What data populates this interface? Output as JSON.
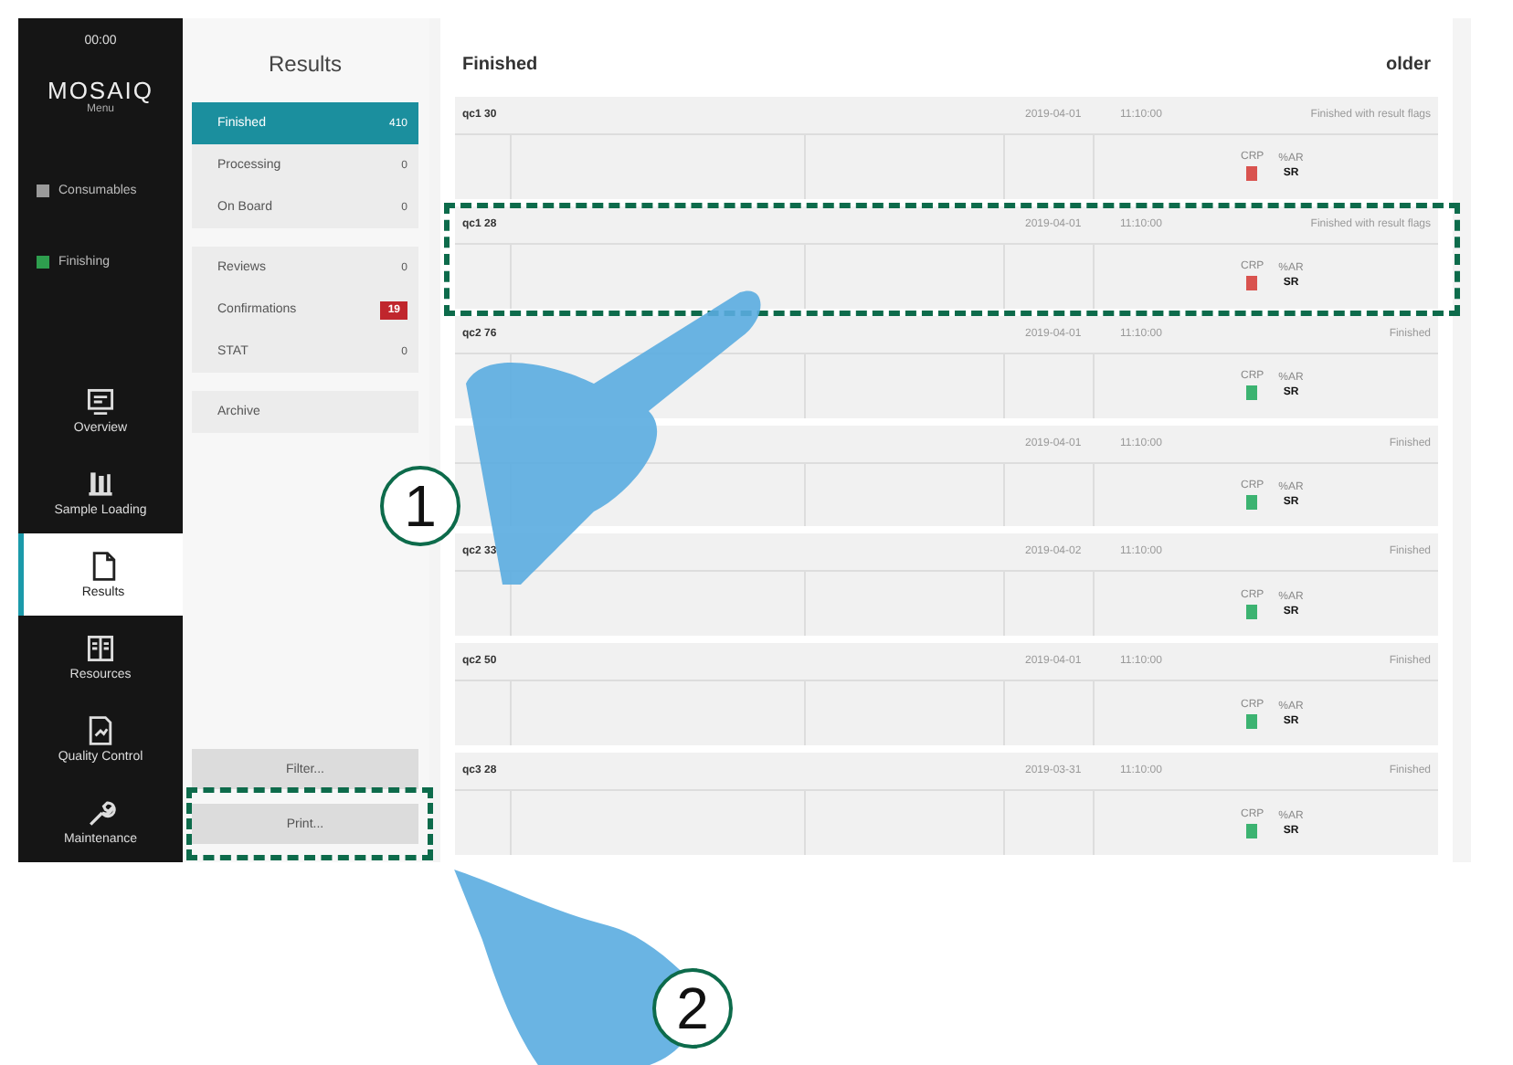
{
  "nav": {
    "time": "00:00",
    "logo": "MOSAIQ",
    "logo_sub": "Menu",
    "status_items": [
      {
        "label": "Consumables",
        "color": "#9a9a9a"
      },
      {
        "label": "Finishing",
        "color": "#2e9e4e"
      }
    ],
    "items": [
      {
        "label": "Overview",
        "selected": false
      },
      {
        "label": "Sample Loading",
        "selected": false
      },
      {
        "label": "Results",
        "selected": true
      },
      {
        "label": "Resources",
        "selected": false
      },
      {
        "label": "Quality Control",
        "selected": false
      },
      {
        "label": "Maintenance",
        "selected": false
      }
    ]
  },
  "panel": {
    "title": "Results",
    "groups": [
      [
        {
          "label": "Finished",
          "count": "410",
          "selected": true,
          "alert": false
        },
        {
          "label": "Processing",
          "count": "0",
          "selected": false,
          "alert": false
        },
        {
          "label": "On Board",
          "count": "0",
          "selected": false,
          "alert": false
        }
      ],
      [
        {
          "label": "Reviews",
          "count": "0",
          "selected": false,
          "alert": false
        },
        {
          "label": "Confirmations",
          "count": "19",
          "selected": false,
          "alert": true
        },
        {
          "label": "STAT",
          "count": "0",
          "selected": false,
          "alert": false
        }
      ],
      [
        {
          "label": "Archive",
          "selected": false
        }
      ]
    ],
    "buttons": [
      "Filter...",
      "Print..."
    ]
  },
  "main": {
    "title": "Finished",
    "sort": "older",
    "rows": [
      {
        "id": "qc1 30",
        "date": "2019-04-01",
        "time": "11:10:00",
        "status": "Finished with result flags",
        "code": "CRP",
        "unit": "%AR",
        "color": "#d9534f",
        "value": "SR",
        "highlighted": false
      },
      {
        "id": "qc1 28",
        "date": "2019-04-01",
        "time": "11:10:00",
        "status": "Finished with result flags",
        "code": "CRP",
        "unit": "%AR",
        "color": "#d9534f",
        "value": "SR",
        "highlighted": true
      },
      {
        "id": "qc2 76",
        "date": "2019-04-01",
        "time": "11:10:00",
        "status": "Finished",
        "code": "CRP",
        "unit": "%AR",
        "color": "#3cb371",
        "value": "SR",
        "highlighted": false
      },
      {
        "date": "2019-04-01",
        "time": "11:10:00",
        "status": "Finished",
        "code": "CRP",
        "unit": "%AR",
        "color": "#3cb371",
        "value": "SR",
        "highlighted": false
      },
      {
        "id": "qc2 33",
        "date": "2019-04-02",
        "time": "11:10:00",
        "status": "Finished",
        "code": "CRP",
        "unit": "%AR",
        "color": "#3cb371",
        "value": "SR",
        "highlighted": false
      },
      {
        "id": "qc2 50",
        "date": "2019-04-01",
        "time": "11:10:00",
        "status": "Finished",
        "code": "CRP",
        "unit": "%AR",
        "color": "#3cb371",
        "value": "SR",
        "highlighted": false
      },
      {
        "id": "qc3 28",
        "date": "2019-03-31",
        "time": "11:10:00",
        "status": "Finished",
        "code": "CRP",
        "unit": "%AR",
        "color": "#3cb371",
        "value": "SR",
        "highlighted": false
      }
    ]
  },
  "callouts": [
    {
      "number": "1"
    },
    {
      "number": "2"
    }
  ],
  "highlight_print": true
}
